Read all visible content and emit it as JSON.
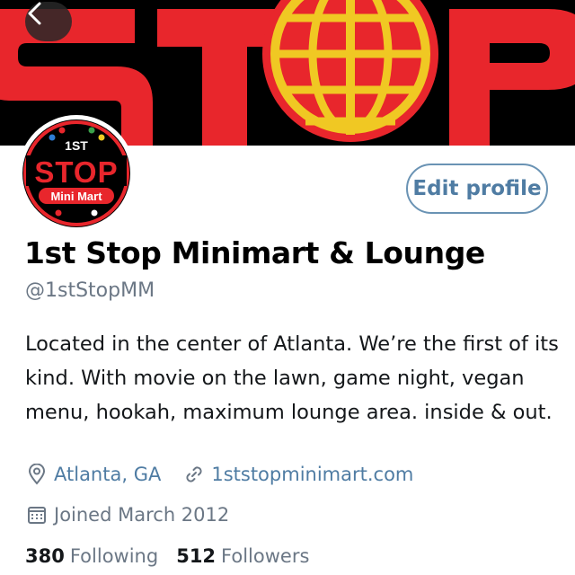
{
  "banner": {
    "logo_text": "STOP",
    "colors": {
      "background": "#000000",
      "letters": "#e8262c",
      "globe_lines": "#f0c823"
    },
    "back_icon": "chevron-left-icon"
  },
  "avatar": {
    "top_text": "1ST",
    "main_text": "STOP",
    "bottom_text": "Mini Mart"
  },
  "profile": {
    "edit_label": "Edit profile",
    "name": "1st Stop Minimart & Lounge",
    "handle": "@1stStopMM",
    "bio": "Located in the center of Atlanta. We’re the first of its kind. With movie on the lawn, game night, vegan menu, hookah, maximum lounge area. inside & out.",
    "location": "Atlanta, GA",
    "website": "1ststopminimart.com",
    "joined": "Joined March 2012"
  },
  "stats": {
    "following_count": "380",
    "following_label": "Following",
    "followers_count": "512",
    "followers_label": "Followers"
  },
  "colors": {
    "accent": "#4f7ca3",
    "muted": "#6b7785",
    "text": "#14171a"
  }
}
